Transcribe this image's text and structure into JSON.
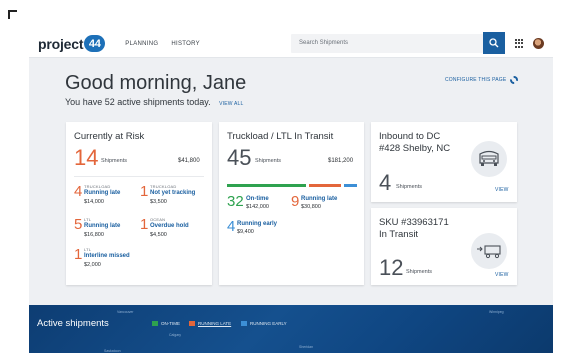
{
  "header": {
    "logo_text": "project",
    "logo_badge": "44",
    "nav": [
      "PLANNING",
      "HISTORY"
    ],
    "search_placeholder": "Search Shipments",
    "icons": [
      "search-icon",
      "apps-grid-icon",
      "user-avatar"
    ]
  },
  "greeting": {
    "title": "Good morning, Jane",
    "subtitle": "You have 52 active shipments today.",
    "view_all": "VIEW ALL",
    "configure": "CONFIGURE THIS PAGE"
  },
  "at_risk": {
    "title": "Currently at Risk",
    "count": "14",
    "count_label": "Shipments",
    "amount": "$41,800",
    "items": [
      {
        "num": "4",
        "mode": "TRUCKLOAD",
        "status": "Running late",
        "value": "$14,000"
      },
      {
        "num": "1",
        "mode": "TRUCKLOAD",
        "status": "Not yet tracking",
        "value": "$3,500"
      },
      {
        "num": "5",
        "mode": "LTL",
        "status": "Running late",
        "value": "$16,800"
      },
      {
        "num": "1",
        "mode": "OCEAN",
        "status": "Overdue hold",
        "value": "$4,500"
      },
      {
        "num": "1",
        "mode": "LTL",
        "status": "Interline missed",
        "value": "$2,000"
      }
    ]
  },
  "in_transit": {
    "title": "Truckload / LTL In Transit",
    "count": "45",
    "count_label": "Shipments",
    "amount": "$181,200",
    "items": [
      {
        "num": "32",
        "status": "On-time",
        "value": "$142,000",
        "color": "#2ea24f"
      },
      {
        "num": "9",
        "status": "Running late",
        "value": "$30,800",
        "color": "#e3663b"
      },
      {
        "num": "4",
        "status": "Running early",
        "value": "$9,400",
        "color": "#3c8fd6"
      }
    ],
    "bar_colors": [
      "#2ea24f",
      "#e3663b",
      "#3c8fd6"
    ]
  },
  "inbound": {
    "title_line1": "Inbound to DC",
    "title_line2": "#428 Shelby, NC",
    "count": "4",
    "count_label": "Shipments",
    "view": "VIEW"
  },
  "sku": {
    "title_line1": "SKU #33963171",
    "title_line2": "In Transit",
    "count": "12",
    "count_label": "Shipments",
    "view": "VIEW"
  },
  "active": {
    "title": "Active shipments",
    "legend": [
      {
        "label": "ON-TIME",
        "color": "#2ea24f"
      },
      {
        "label": "RUNNING LATE",
        "color": "#e3663b"
      },
      {
        "label": "RUNNING EARLY",
        "color": "#3c8fd6"
      }
    ],
    "map_labels": [
      "Vancouver",
      "Calgary",
      "Winnipeg",
      "Sheridan",
      "Saskatoon"
    ]
  }
}
